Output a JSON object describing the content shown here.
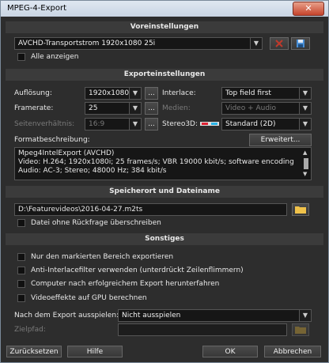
{
  "window": {
    "title": "MPEG-4-Export",
    "close": "✕"
  },
  "sections": {
    "presets": "Voreinstellungen",
    "export": "Exporteinstellungen",
    "location": "Speicherort und Dateiname",
    "misc": "Sonstiges"
  },
  "presets": {
    "selected": "AVCHD-Transportstrom 1920x1080 25i",
    "show_all": "Alle anzeigen"
  },
  "export": {
    "resolution_label": "Auflösung:",
    "resolution_value": "1920x1080",
    "framerate_label": "Framerate:",
    "framerate_value": "25",
    "aspect_label": "Seitenverhältnis:",
    "aspect_value": "16:9",
    "more": "...",
    "interlace_label": "Interlace:",
    "interlace_value": "Top field first",
    "media_label": "Medien:",
    "media_value": "Video + Audio",
    "stereo_label": "Stereo3D:",
    "stereo_value": "Standard (2D)",
    "format_desc_label": "Formatbeschreibung:",
    "advanced_button": "Erweitert...",
    "format_desc_lines": [
      "Mpeg4IntelExport (AVCHD)",
      "Video: H.264; 1920x1080i; 25 frames/s; VBR 19000 kbit/s; software encoding",
      "Audio: AC-3; Stereo; 48000 Hz; 384 kbit/s"
    ]
  },
  "location": {
    "path": "D:\\Featurevideos\\2016-04-27.m2ts",
    "overwrite": "Datei ohne Rückfrage überschreiben"
  },
  "misc": {
    "options": [
      "Nur den markierten Bereich exportieren",
      "Anti-Interlacefilter verwenden (unterdrückt Zeilenflimmern)",
      "Computer nach erfolgreichem Export herunterfahren",
      "Videoeffekte auf GPU berechnen"
    ],
    "after_export_label": "Nach dem Export ausspielen:",
    "after_export_value": "Nicht ausspielen",
    "target_path_label": "Zielpfad:"
  },
  "footer": {
    "reset": "Zurücksetzen",
    "help": "Hilfe",
    "ok": "OK",
    "cancel": "Abbrechen"
  }
}
